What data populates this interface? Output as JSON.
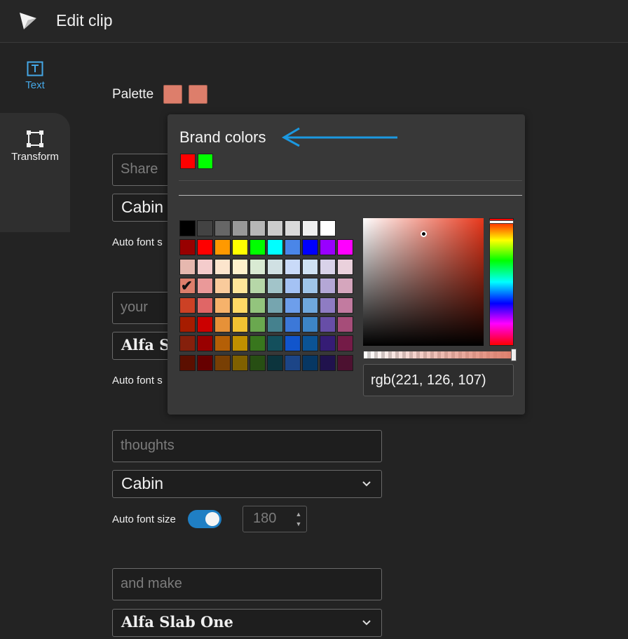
{
  "header": {
    "title": "Edit clip",
    "logo_icon": "paper-plane-logo-icon"
  },
  "sidebar": {
    "items": [
      {
        "label": "Text",
        "icon": "text-box-icon",
        "active": true
      },
      {
        "label": "Transform",
        "icon": "transform-square-icon",
        "active": false
      }
    ]
  },
  "palette": {
    "label": "Palette",
    "swatches": [
      "#dd7e6b",
      "#dd7e6b"
    ]
  },
  "text_blocks": [
    {
      "placeholder": "Share",
      "font": "Cabin",
      "auto_label": "Auto font s"
    },
    {
      "placeholder": "your",
      "font": "Alfa S",
      "auto_label": "Auto font s"
    },
    {
      "placeholder": "thoughts",
      "font": "Cabin",
      "auto_label": "Auto font size",
      "auto_enabled": true,
      "size_value": "180"
    },
    {
      "placeholder": "and make",
      "font": "Alfa Slab One"
    }
  ],
  "color_picker": {
    "title": "Brand colors",
    "brand_colors": [
      "#ff0000",
      "#00ff00"
    ],
    "selected_color": "#dd7e6b",
    "value_text": "rgb(221, 126, 107)",
    "grid": [
      [
        "#000000",
        "#434343",
        "#666666",
        "#999999",
        "#b7b7b7",
        "#cccccc",
        "#d9d9d9",
        "#efefef",
        "#ffffff"
      ],
      [
        "#980000",
        "#ff0000",
        "#ff9900",
        "#ffff00",
        "#00ff00",
        "#00ffff",
        "#4a86e8",
        "#0000ff",
        "#9900ff",
        "#ff00ff"
      ],
      [
        "#e6b8af",
        "#f4cccc",
        "#fce5cd",
        "#fff2cc",
        "#d9ead3",
        "#d0e0e3",
        "#c9daf8",
        "#cfe2f3",
        "#d9d2e9",
        "#ead1dc"
      ],
      [
        "#dd7e6b",
        "#ea9999",
        "#f9cb9c",
        "#ffe599",
        "#b6d7a8",
        "#a2c4c9",
        "#a4c2f4",
        "#9fc5e8",
        "#b4a7d6",
        "#d5a6bd"
      ],
      [
        "#cc4125",
        "#e06666",
        "#f6b26b",
        "#ffd966",
        "#93c47d",
        "#76a5af",
        "#6d9eeb",
        "#6fa8dc",
        "#8e7cc3",
        "#c27ba0"
      ],
      [
        "#a61c00",
        "#cc0000",
        "#e69138",
        "#f1c232",
        "#6aa84f",
        "#45818e",
        "#3c78d8",
        "#3d85c6",
        "#674ea7",
        "#a64d79"
      ],
      [
        "#85200c",
        "#990000",
        "#b45f06",
        "#bf9000",
        "#38761d",
        "#134f5c",
        "#1155cc",
        "#0b5394",
        "#351c75",
        "#741b47"
      ],
      [
        "#5b0f00",
        "#660000",
        "#783f04",
        "#7f6000",
        "#274e13",
        "#0c343d",
        "#1c4587",
        "#073763",
        "#20124d",
        "#4c1130"
      ]
    ]
  }
}
